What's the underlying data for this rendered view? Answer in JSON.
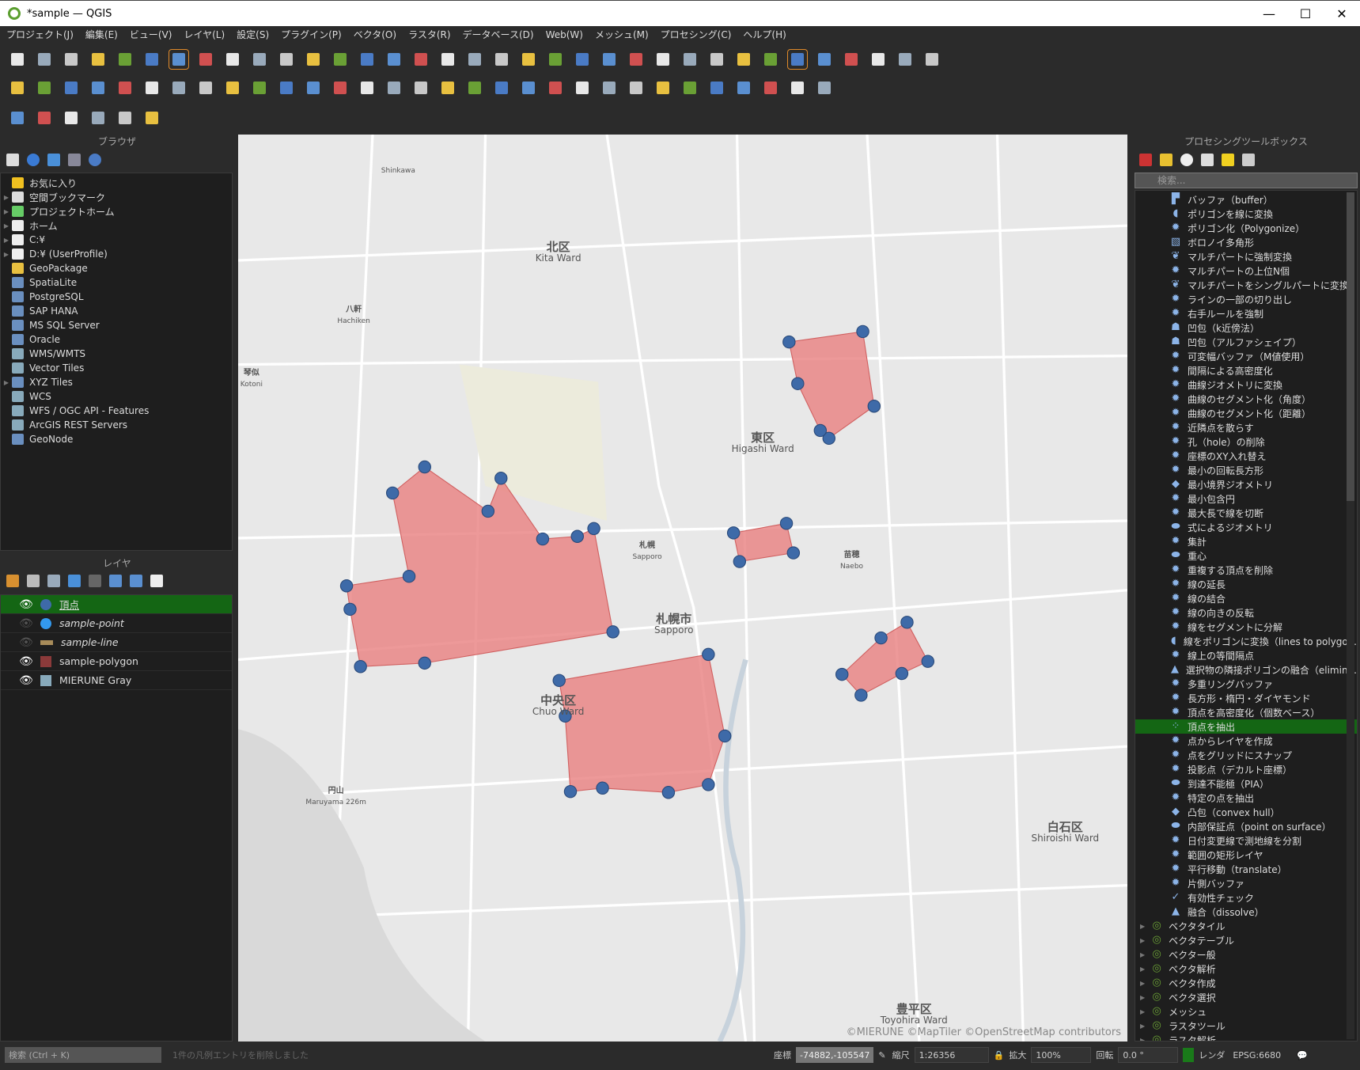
{
  "window": {
    "title": "*sample — QGIS",
    "minimize": "—",
    "maximize": "☐",
    "close": "✕"
  },
  "menu": [
    "プロジェクト(J)",
    "編集(E)",
    "ビュー(V)",
    "レイヤ(L)",
    "設定(S)",
    "プラグイン(P)",
    "ベクタ(O)",
    "ラスタ(R)",
    "データベース(D)",
    "Web(W)",
    "メッシュ(M)",
    "プロセシング(C)",
    "ヘルプ(H)"
  ],
  "toolbars": [
    [
      "new-project",
      "open-project",
      "save-project",
      "save-as",
      "print-layout",
      "style-manager",
      "pan",
      "pan-to-selection",
      "zoom-in",
      "zoom-out",
      "zoom-full",
      "zoom-selection",
      "zoom-layer",
      "zoom-native",
      "zoom-last",
      "zoom-next",
      "new-map-view",
      "new-3d-view",
      "new-bookmark",
      "show-bookmarks",
      "temporal",
      "refresh",
      "select-features",
      "select-dropdown",
      "attribute-select",
      "deselect",
      "select-location",
      "identify",
      "statistics",
      "processing-toolbox",
      "sum",
      "attribute-table",
      "measure",
      "map-tips",
      "settings"
    ],
    [
      "data-source-manager",
      "new-geopackage",
      "new-temp-layer",
      "digitize",
      "new-shapefile",
      "virtual-layer",
      "new-spatialite",
      "edit-pencil",
      "toggle-editing",
      "save-edits",
      "add-feature",
      "vertex-tool",
      "modify-attributes",
      "delete-selected",
      "cut",
      "copy",
      "paste",
      "undo",
      "redo",
      "label-abc",
      "diagram",
      "label-pin",
      "label-highlight",
      "label-move",
      "label-rotate",
      "label-change",
      "label-show",
      "label-history",
      "python-qgis",
      "python-console",
      "help"
    ],
    [
      "add-wms",
      "add-wfs",
      "add-point",
      "add-vertex",
      "upload",
      "georeference"
    ]
  ],
  "browser": {
    "title": "ブラウザ",
    "items": [
      {
        "label": "お気に入り",
        "icon": "star",
        "color": "#f0c020",
        "arrow": false
      },
      {
        "label": "空間ブックマーク",
        "icon": "bookmark",
        "color": "#ddd",
        "arrow": true
      },
      {
        "label": "プロジェクトホーム",
        "icon": "project-home",
        "color": "#6c6",
        "arrow": true
      },
      {
        "label": "ホーム",
        "icon": "home",
        "color": "#eee",
        "arrow": true
      },
      {
        "label": "C:¥",
        "icon": "folder",
        "color": "#eee",
        "arrow": true
      },
      {
        "label": "D:¥ (UserProfile)",
        "icon": "folder",
        "color": "#eee",
        "arrow": true
      },
      {
        "label": "GeoPackage",
        "icon": "geopackage",
        "color": "#e8c040",
        "arrow": false
      },
      {
        "label": "SpatiaLite",
        "icon": "spatialite",
        "color": "#6a8fbf",
        "arrow": false
      },
      {
        "label": "PostgreSQL",
        "icon": "postgresql",
        "color": "#6a8fbf",
        "arrow": false
      },
      {
        "label": "SAP HANA",
        "icon": "sap-hana",
        "color": "#6a8fbf",
        "arrow": false
      },
      {
        "label": "MS SQL Server",
        "icon": "mssql",
        "color": "#6a8fbf",
        "arrow": false
      },
      {
        "label": "Oracle",
        "icon": "oracle",
        "color": "#6a8fbf",
        "arrow": false
      },
      {
        "label": "WMS/WMTS",
        "icon": "globe",
        "color": "#8ab",
        "arrow": false
      },
      {
        "label": "Vector Tiles",
        "icon": "grid",
        "color": "#8ab",
        "arrow": false
      },
      {
        "label": "XYZ Tiles",
        "icon": "grid",
        "color": "#6a8fbf",
        "arrow": true
      },
      {
        "label": "WCS",
        "icon": "globe",
        "color": "#8ab",
        "arrow": false
      },
      {
        "label": "WFS / OGC API - Features",
        "icon": "globe",
        "color": "#8ab",
        "arrow": false
      },
      {
        "label": "ArcGIS REST Servers",
        "icon": "globe",
        "color": "#8ab",
        "arrow": false
      },
      {
        "label": "GeoNode",
        "icon": "geonode",
        "color": "#6a8fbf",
        "arrow": false
      }
    ]
  },
  "layers": {
    "title": "レイヤ",
    "items": [
      {
        "name": "頂点",
        "visible": true,
        "selected": true,
        "symbol": "point",
        "color": "#3e6aa8"
      },
      {
        "name": "sample-point",
        "visible": false,
        "selected": false,
        "symbol": "point",
        "color": "#3399ee"
      },
      {
        "name": "sample-line",
        "visible": false,
        "selected": false,
        "symbol": "line",
        "color": "#a88c5a"
      },
      {
        "name": "sample-polygon",
        "visible": true,
        "selected": false,
        "symbol": "polygon",
        "color": "#8b3a3a"
      },
      {
        "name": "MIERUNE Gray",
        "visible": true,
        "selected": false,
        "symbol": "raster",
        "color": "#8ab"
      }
    ]
  },
  "map": {
    "labels": [
      {
        "jp": "北区",
        "en": "Kita Ward"
      },
      {
        "jp": "東区",
        "en": "Higashi Ward"
      },
      {
        "jp": "札幌市",
        "en": "Sapporo"
      },
      {
        "jp": "中央区",
        "en": "Chuo Ward"
      },
      {
        "jp": "白石区",
        "en": "Shiroishi Ward"
      },
      {
        "jp": "豊平区",
        "en": "Toyohira Ward"
      },
      {
        "jp": "",
        "en": "Shinkawa"
      },
      {
        "jp": "八軒",
        "en": "Hachiken"
      },
      {
        "jp": "琴似",
        "en": "Kotoni"
      },
      {
        "jp": "札幌",
        "en": "Sapporo"
      },
      {
        "jp": "苗穂",
        "en": "Naebo"
      },
      {
        "jp": "円山",
        "en": "Maruyama 226m"
      }
    ],
    "attribution": "©MIERUNE ©MapTiler ©OpenStreetMap contributors",
    "polygon_fill": "#e88080",
    "vertex_color": "#3e6aa8"
  },
  "processing": {
    "title": "プロセシングツールボックス",
    "search_placeholder": "検索...",
    "items": [
      {
        "label": "バッファ（buffer）",
        "icon": "▛"
      },
      {
        "label": "ポリゴンを線に変換",
        "icon": "◖"
      },
      {
        "label": "ポリゴン化（Polygonize）",
        "icon": "✹"
      },
      {
        "label": "ボロノイ多角形",
        "icon": "▧"
      },
      {
        "label": "マルチパートに強制変換",
        "icon": "❦"
      },
      {
        "label": "マルチパートの上位N個",
        "icon": "✹"
      },
      {
        "label": "マルチパートをシングルパートに変換",
        "icon": "❦"
      },
      {
        "label": "ラインの一部の切り出し",
        "icon": "✹"
      },
      {
        "label": "右手ルールを強制",
        "icon": "✹"
      },
      {
        "label": "凹包（k近傍法）",
        "icon": "☗"
      },
      {
        "label": "凹包（アルファシェイプ）",
        "icon": "☗"
      },
      {
        "label": "可変幅バッファ（M値使用）",
        "icon": "✹"
      },
      {
        "label": "間隔による高密度化",
        "icon": "✹"
      },
      {
        "label": "曲線ジオメトリに変換",
        "icon": "✹"
      },
      {
        "label": "曲線のセグメント化（角度）",
        "icon": "✹"
      },
      {
        "label": "曲線のセグメント化（距離）",
        "icon": "✹"
      },
      {
        "label": "近隣点を散らす",
        "icon": "✹"
      },
      {
        "label": "孔（hole）の削除",
        "icon": "✹"
      },
      {
        "label": "座標のXY入れ替え",
        "icon": "✹"
      },
      {
        "label": "最小の回転長方形",
        "icon": "✹"
      },
      {
        "label": "最小境界ジオメトリ",
        "icon": "◆"
      },
      {
        "label": "最小包含円",
        "icon": "✹"
      },
      {
        "label": "最大長で線を切断",
        "icon": "✹"
      },
      {
        "label": "式によるジオメトリ",
        "icon": "⬬"
      },
      {
        "label": "集計",
        "icon": "✹"
      },
      {
        "label": "重心",
        "icon": "⬬"
      },
      {
        "label": "重複する頂点を削除",
        "icon": "✹"
      },
      {
        "label": "線の延長",
        "icon": "✹"
      },
      {
        "label": "線の結合",
        "icon": "✹"
      },
      {
        "label": "線の向きの反転",
        "icon": "✹"
      },
      {
        "label": "線をセグメントに分解",
        "icon": "✹"
      },
      {
        "label": "線をポリゴンに変換（lines to polygo...",
        "icon": "◖"
      },
      {
        "label": "線上の等間隔点",
        "icon": "✹"
      },
      {
        "label": "選択物の隣接ポリゴンの融合（elimin...",
        "icon": "▲"
      },
      {
        "label": "多重リングバッファ",
        "icon": "✹"
      },
      {
        "label": "長方形・楕円・ダイヤモンド",
        "icon": "✹"
      },
      {
        "label": "頂点を高密度化（個数ベース）",
        "icon": "✹"
      },
      {
        "label": "頂点を抽出",
        "icon": "⁘",
        "selected": true
      },
      {
        "label": "点からレイヤを作成",
        "icon": "✹"
      },
      {
        "label": "点をグリッドにスナップ",
        "icon": "✹"
      },
      {
        "label": "投影点（デカルト座標）",
        "icon": "✹"
      },
      {
        "label": "到達不能極（PIA）",
        "icon": "⬬"
      },
      {
        "label": "特定の点を抽出",
        "icon": "✹"
      },
      {
        "label": "凸包（convex hull）",
        "icon": "◆"
      },
      {
        "label": "内部保証点（point on surface）",
        "icon": "⬬"
      },
      {
        "label": "日付変更線で測地線を分割",
        "icon": "✹"
      },
      {
        "label": "範囲の矩形レイヤ",
        "icon": "✹"
      },
      {
        "label": "平行移動（translate）",
        "icon": "✹"
      },
      {
        "label": "片側バッファ",
        "icon": "✹"
      },
      {
        "label": "有効性チェック",
        "icon": "✓"
      },
      {
        "label": "融合（dissolve）",
        "icon": "▲"
      }
    ],
    "groups": [
      "ベクタタイル",
      "ベクタテーブル",
      "ベクター般",
      "ベクタ解析",
      "ベクタ作成",
      "ベクタ選択",
      "メッシュ",
      "ラスタツール",
      "ラスタ解析"
    ]
  },
  "status": {
    "search_placeholder": "検索 (Ctrl + K)",
    "message": "1件の凡例エントリを削除しました",
    "coord_label": "座標",
    "coord": "-74882,-105547",
    "scale_label": "縮尺",
    "scale": "1:26356",
    "magnify_label": "拡大",
    "magnify": "100%",
    "rotation_label": "回転",
    "rotation": "0.0 °",
    "render_label": "レンダ",
    "crs": "EPSG:6680"
  }
}
